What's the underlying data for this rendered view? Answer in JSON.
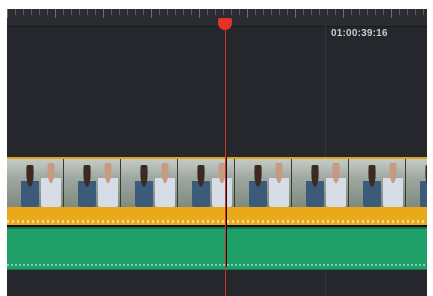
{
  "timeline": {
    "timecode": "01:00:39:16"
  },
  "tracks": {
    "video": {
      "clip_thumbnails": [
        "thumbnail",
        "thumbnail",
        "thumbnail",
        "thumbnail",
        "thumbnail",
        "thumbnail",
        "thumbnail",
        "thumbnail"
      ]
    },
    "audio_1_color": "#e8a91a",
    "audio_2_color": "#1fa068",
    "video_border_color": "#e0a41a"
  },
  "playhead": {
    "color": "#e4312b"
  }
}
